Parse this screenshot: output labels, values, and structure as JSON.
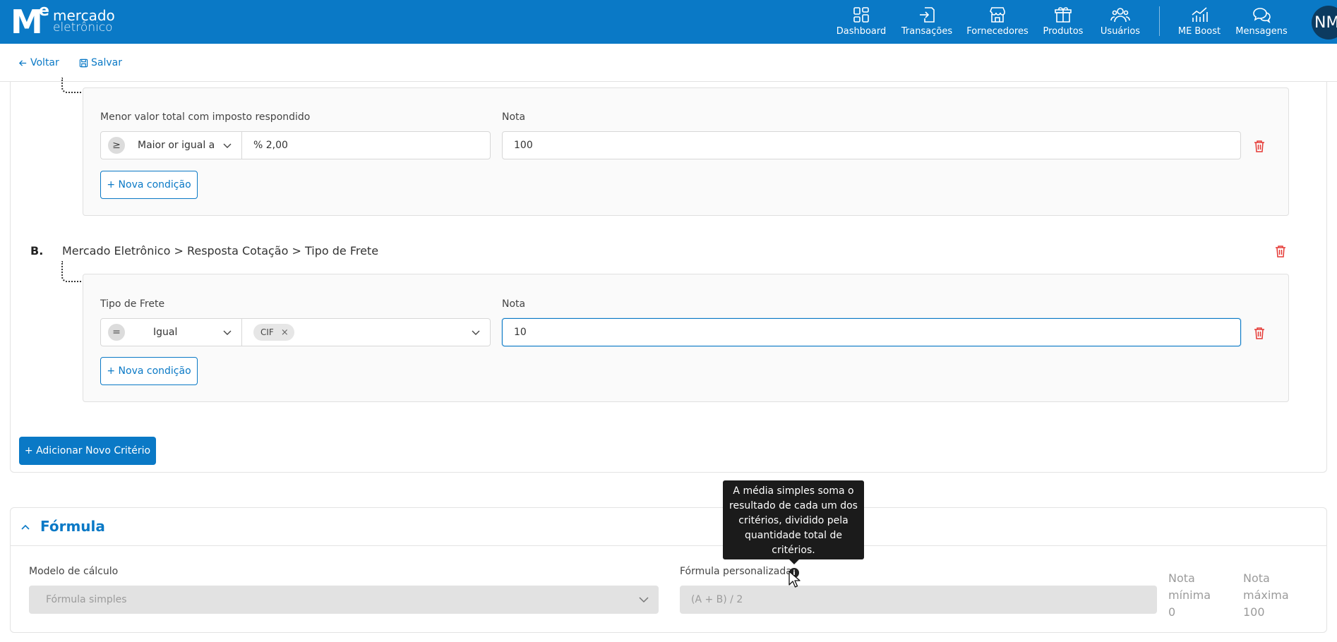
{
  "brand": {
    "line1": "mercado",
    "line2": "eletrônico",
    "letter_m": "M",
    "letter_e": "e"
  },
  "nav": [
    {
      "label": "Dashboard",
      "icon": "dashboard-icon"
    },
    {
      "label": "Transações",
      "icon": "transactions-icon"
    },
    {
      "label": "Fornecedores",
      "icon": "suppliers-icon"
    },
    {
      "label": "Produtos",
      "icon": "products-icon"
    },
    {
      "label": "Usuários",
      "icon": "users-icon"
    },
    {
      "label": "ME Boost",
      "icon": "boost-chart-icon"
    },
    {
      "label": "Mensagens",
      "icon": "messages-icon"
    }
  ],
  "user": {
    "initials": "NM"
  },
  "toolbar": {
    "back_label": "Voltar",
    "save_label": "Salvar"
  },
  "criteria": {
    "a": {
      "field_label": "Menor valor total com imposto respondido",
      "operator_symbol": "≥",
      "operator_label": "Maior or igual a",
      "value": "% 2,00",
      "score_label": "Nota",
      "score_value": "100",
      "add_condition": "+ Nova condição"
    },
    "b": {
      "letter": "B.",
      "path": "Mercado Eletrônico > Resposta Cotação > Tipo de Frete",
      "field_label": "Tipo de Frete",
      "operator_symbol": "=",
      "operator_label": "Igual",
      "chip": "CIF",
      "chip_remove": "×",
      "score_label": "Nota",
      "score_value": "10",
      "add_condition": "+ Nova condição"
    },
    "add_criterion": "+ Adicionar Novo Critério"
  },
  "formula": {
    "title": "Fórmula",
    "model_label": "Modelo de cálculo",
    "model_value": "Fórmula simples",
    "custom_label": "Fórmula personalizada",
    "custom_value": "(A + B) / 2",
    "min_label_1": "Nota",
    "min_label_2": "mínima",
    "min_value": "0",
    "max_label_1": "Nota",
    "max_label_2": "máxima",
    "max_value": "100",
    "info_glyph": "i",
    "tooltip": "A média simples soma o resultado de cada um dos critérios, dividido pela quantidade total de critérios."
  },
  "colors": {
    "brand_blue": "#0a79c6",
    "danger_red": "#e53935",
    "avatar_bg": "#0c3b60"
  }
}
